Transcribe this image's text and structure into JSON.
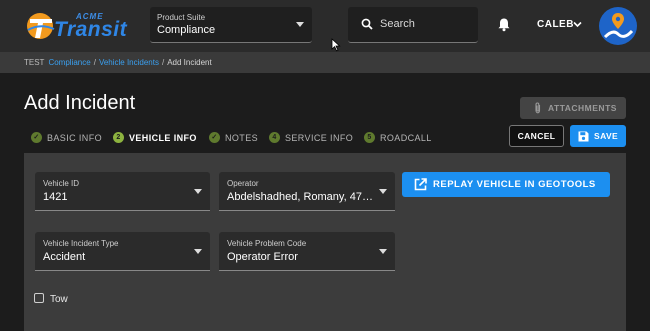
{
  "header": {
    "logo": {
      "brand_small": "ACME",
      "brand_large": "Transit"
    },
    "product_suite": {
      "label": "Product Suite",
      "value": "Compliance"
    },
    "search": {
      "placeholder": "Search"
    },
    "user": {
      "name": "CALEB"
    },
    "icons": {
      "search": "search-icon",
      "notifications": "bell-icon",
      "user_menu": "chevron-down-icon",
      "avatar": "map-pin-avatar-icon"
    }
  },
  "breadcrumb": {
    "env": "TEST",
    "items": [
      "Compliance",
      "Vehicle Incidents",
      "Add Incident"
    ],
    "separator": "/"
  },
  "page": {
    "title": "Add Incident",
    "attachments_label": "ATTACHMENTS",
    "cancel_label": "CANCEL",
    "save_label": "SAVE"
  },
  "steps": [
    {
      "label": "BASIC INFO",
      "marker": "✓",
      "state": "complete"
    },
    {
      "label": "VEHICLE INFO",
      "marker": "2",
      "state": "active"
    },
    {
      "label": "NOTES",
      "marker": "✓",
      "state": "complete"
    },
    {
      "label": "SERVICE INFO",
      "marker": "4",
      "state": "pending"
    },
    {
      "label": "ROADCALL",
      "marker": "5",
      "state": "pending"
    }
  ],
  "form": {
    "vehicle_id": {
      "label": "Vehicle ID",
      "value": "1421"
    },
    "operator": {
      "label": "Operator",
      "value": "Abdelshadhed, Romany, 47…"
    },
    "incident_type": {
      "label": "Vehicle Incident Type",
      "value": "Accident"
    },
    "problem_code": {
      "label": "Vehicle Problem Code",
      "value": "Operator Error"
    },
    "replay_button": "REPLAY VEHICLE IN GEOTOOLS",
    "tow": {
      "label": "Tow",
      "checked": false
    }
  },
  "colors": {
    "accent": "#1c8ff0",
    "topbar": "#2b2b2b",
    "background": "#1c1c1c",
    "panel": "#3c3c3c",
    "step_complete": "#8db33f",
    "link": "#3aa0f0"
  }
}
